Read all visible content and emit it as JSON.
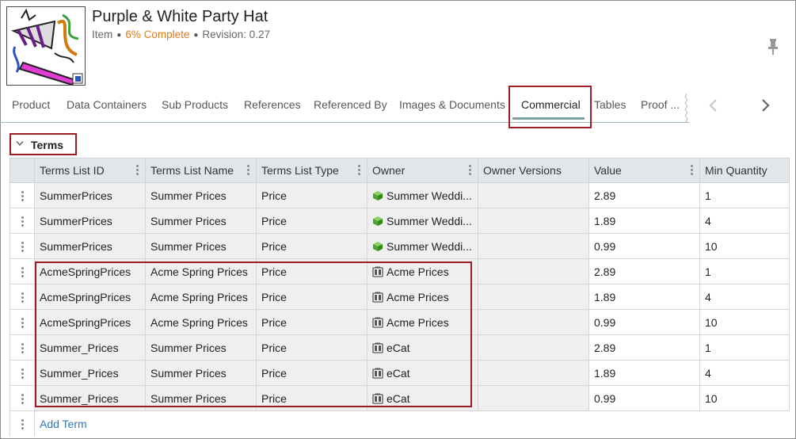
{
  "header": {
    "title": "Purple & White Party Hat",
    "item_type": "Item",
    "completeness": "6% Complete",
    "revision": "Revision: 0.27"
  },
  "tabs": [
    {
      "label": "Product"
    },
    {
      "label": "Data Containers"
    },
    {
      "label": "Sub Products"
    },
    {
      "label": "References"
    },
    {
      "label": "Referenced By"
    },
    {
      "label": "Images & Documents"
    },
    {
      "label": "Commercial",
      "active": true
    },
    {
      "label": "Tables"
    },
    {
      "label": "Proof ..."
    }
  ],
  "section": {
    "title": "Terms"
  },
  "table": {
    "columns": [
      "Terms List ID",
      "Terms List Name",
      "Terms List Type",
      "Owner",
      "Owner Versions",
      "Value",
      "Min Quantity"
    ],
    "rows": [
      {
        "id": "SummerPrices",
        "name": "Summer Prices",
        "type": "Price",
        "owner": "Summer Weddi...",
        "owner_icon": "green-cube-icon",
        "versions": "",
        "value": "2.89",
        "min_qty": "1"
      },
      {
        "id": "SummerPrices",
        "name": "Summer Prices",
        "type": "Price",
        "owner": "Summer Weddi...",
        "owner_icon": "green-cube-icon",
        "versions": "",
        "value": "1.89",
        "min_qty": "4"
      },
      {
        "id": "SummerPrices",
        "name": "Summer Prices",
        "type": "Price",
        "owner": "Summer Weddi...",
        "owner_icon": "green-cube-icon",
        "versions": "",
        "value": "0.99",
        "min_qty": "10"
      },
      {
        "id": "AcmeSpringPrices",
        "name": "Acme Spring Prices",
        "type": "Price",
        "owner": "Acme Prices",
        "owner_icon": "catalog-icon",
        "versions": "",
        "value": "2.89",
        "min_qty": "1"
      },
      {
        "id": "AcmeSpringPrices",
        "name": "Acme Spring Prices",
        "type": "Price",
        "owner": "Acme Prices",
        "owner_icon": "catalog-icon",
        "versions": "",
        "value": "1.89",
        "min_qty": "4"
      },
      {
        "id": "AcmeSpringPrices",
        "name": "Acme Spring Prices",
        "type": "Price",
        "owner": "Acme Prices",
        "owner_icon": "catalog-icon",
        "versions": "",
        "value": "0.99",
        "min_qty": "10"
      },
      {
        "id": "Summer_Prices",
        "name": "Summer Prices",
        "type": "Price",
        "owner": "eCat",
        "owner_icon": "catalog-icon",
        "versions": "",
        "value": "2.89",
        "min_qty": "1"
      },
      {
        "id": "Summer_Prices",
        "name": "Summer Prices",
        "type": "Price",
        "owner": "eCat",
        "owner_icon": "catalog-icon",
        "versions": "",
        "value": "1.89",
        "min_qty": "4"
      },
      {
        "id": "Summer_Prices",
        "name": "Summer Prices",
        "type": "Price",
        "owner": "eCat",
        "owner_icon": "catalog-icon",
        "versions": "",
        "value": "0.99",
        "min_qty": "10"
      }
    ],
    "add_label": "Add Term"
  },
  "colors": {
    "accent_orange": "#e07b1a",
    "highlight_red": "#9b1c25",
    "link_blue": "#2b7bbd",
    "tab_underline": "#7ea1a6"
  }
}
